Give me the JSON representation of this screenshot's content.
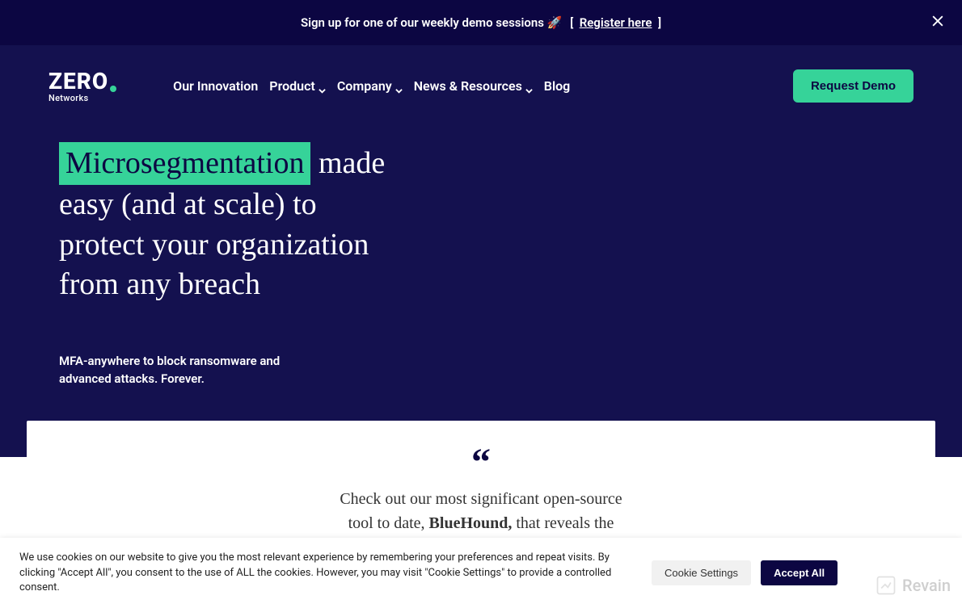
{
  "banner": {
    "text": "Sign up for one of our weekly demo sessions 🚀",
    "link_label": "Register here"
  },
  "logo": {
    "top": "ZERO",
    "sub": "Networks"
  },
  "nav": {
    "innovation": "Our Innovation",
    "product": "Product",
    "company": "Company",
    "news": "News & Resources",
    "blog": "Blog"
  },
  "cta": {
    "demo": "Request Demo"
  },
  "hero": {
    "highlight": "Microsegmentation",
    "rest": " made easy (and at scale) to protect your organization from any breach",
    "sub": "MFA-anywhere to block ransomware and advanced attacks. Forever."
  },
  "quote": {
    "pre": "Check out our most significant open-source tool to date, ",
    "bold": "BlueHound,",
    "post": " that reveals the paths"
  },
  "cookies": {
    "text": "We use cookies on our website to give you the most relevant experience by remembering your preferences and repeat visits. By clicking \"Accept All\", you consent to the use of ALL the cookies. However, you may visit \"Cookie Settings\" to provide a controlled consent.",
    "settings": "Cookie Settings",
    "accept": "Accept All"
  },
  "watermark": "Revain"
}
